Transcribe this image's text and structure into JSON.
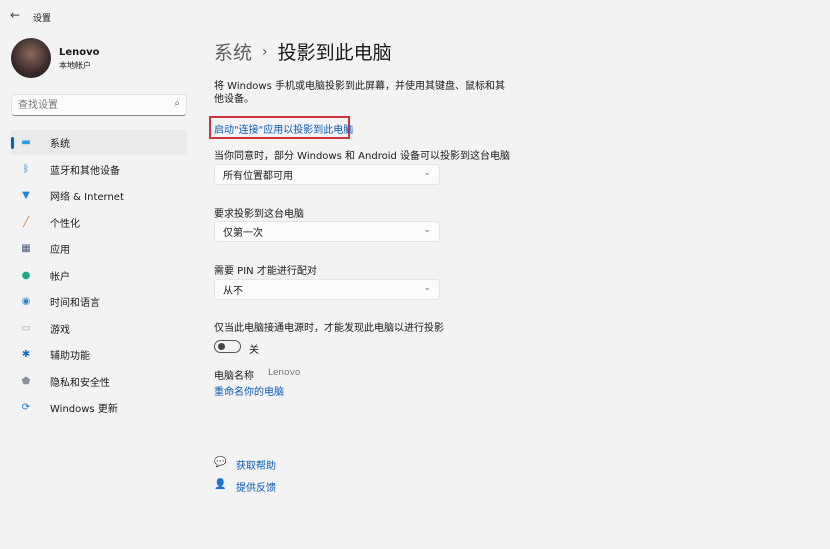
{
  "window": {
    "title": "设置"
  },
  "user": {
    "name": "Lenovo",
    "account": "本地帐户"
  },
  "search": {
    "placeholder": "查找设置"
  },
  "sidebar": {
    "items": [
      {
        "label": "系统",
        "icon": "monitor-icon",
        "color": "#2a9bd8"
      },
      {
        "label": "蓝牙和其他设备",
        "icon": "bluetooth-icon",
        "color": "#0a78d4"
      },
      {
        "label": "网络 & Internet",
        "icon": "wifi-icon",
        "color": "#1c86d6"
      },
      {
        "label": "个性化",
        "icon": "brush-icon",
        "color": "#e07a36"
      },
      {
        "label": "应用",
        "icon": "apps-icon",
        "color": "#4a5a80"
      },
      {
        "label": "帐户",
        "icon": "person-icon",
        "color": "#1aa88a"
      },
      {
        "label": "时间和语言",
        "icon": "globe-clock-icon",
        "color": "#2a86c8"
      },
      {
        "label": "游戏",
        "icon": "gamepad-icon",
        "color": "#9aa0a8"
      },
      {
        "label": "辅助功能",
        "icon": "accessibility-icon",
        "color": "#1070c8"
      },
      {
        "label": "隐私和安全性",
        "icon": "shield-icon",
        "color": "#8a9098"
      },
      {
        "label": "Windows 更新",
        "icon": "update-icon",
        "color": "#0a78d4"
      }
    ]
  },
  "main": {
    "breadcrumb_parent": "系统",
    "breadcrumb_sep": "›",
    "title": "投影到此电脑",
    "description": "将 Windows 手机或电脑投影到此屏幕，并使用其键盘、鼠标和其他设备。",
    "launch_link": "启动\"连接\"应用以投影到此电脑",
    "setting1_label": "当你同意时，部分 Windows 和 Android 设备可以投影到这台电脑",
    "setting1_value": "所有位置都可用",
    "setting2_label": "要求投影到这台电脑",
    "setting2_value": "仅第一次",
    "setting3_label": "需要 PIN 才能进行配对",
    "setting3_value": "从不",
    "setting4_label": "仅当此电脑接通电源时，才能发现此电脑以进行投影",
    "toggle_state": "关",
    "pc_name_label": "电脑名称",
    "pc_name": "Lenovo",
    "rename_link": "重命名你的电脑",
    "help": "获取帮助",
    "feedback": "提供反馈"
  }
}
